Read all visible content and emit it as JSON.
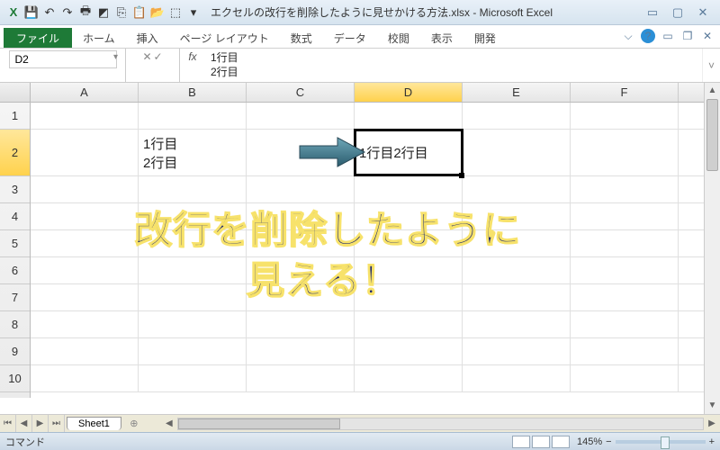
{
  "window": {
    "title": "エクセルの改行を削除したように見せかける方法.xlsx - Microsoft Excel"
  },
  "ribbon": {
    "file": "ファイル",
    "tabs": [
      "ホーム",
      "挿入",
      "ページ レイアウト",
      "数式",
      "データ",
      "校閲",
      "表示",
      "開発"
    ]
  },
  "formula_bar": {
    "name_box": "D2",
    "fx": "fx",
    "value": "1行目\n2行目"
  },
  "grid": {
    "columns": [
      "A",
      "B",
      "C",
      "D",
      "E",
      "F"
    ],
    "active_col": "D",
    "rows": [
      "1",
      "2",
      "3",
      "4",
      "5",
      "6",
      "7",
      "8",
      "9",
      "10"
    ],
    "active_row": "2",
    "cells": {
      "B2": "1行目\n2行目",
      "D2": "1行目2行目"
    },
    "selected": "D2"
  },
  "overlay": {
    "line1": "改行を削除したように",
    "line2": "見える！"
  },
  "sheets": {
    "active": "Sheet1"
  },
  "status": {
    "mode": "コマンド",
    "zoom": "145%",
    "zoom_minus": "−",
    "zoom_plus": "+"
  },
  "icons": {
    "excel": "X",
    "save": "💾",
    "undo": "↶",
    "redo": "↷",
    "print": "🖶",
    "copy": "📋",
    "open": "📂",
    "minimize": "▭",
    "maximize": "▢",
    "close": "✕",
    "help": "?",
    "expand": "˅",
    "dropdown": "▾",
    "nav_first": "⏮",
    "nav_prev": "◀",
    "nav_next": "▶",
    "nav_last": "⏭",
    "left": "◀",
    "right": "▶",
    "up": "▲",
    "down": "▼"
  }
}
